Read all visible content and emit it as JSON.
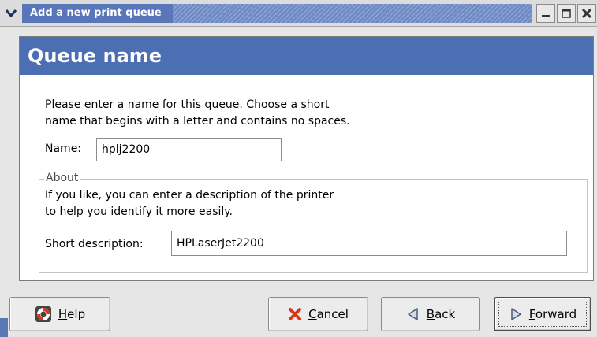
{
  "window": {
    "title": "Add a new print queue"
  },
  "header": {
    "title": "Queue name"
  },
  "instructions": {
    "line1": "Please enter a name for this queue.  Choose a short",
    "line2": "name that begins with a letter and contains no spaces."
  },
  "name_field": {
    "label": "Name:",
    "value": "hplj2200"
  },
  "about": {
    "legend": "About",
    "line1": "If you like, you can enter a description of the printer",
    "line2": "to help you identify it more easily.",
    "short_label": "Short description:",
    "short_value": "HPLaserJet2200"
  },
  "buttons": {
    "help": "Help",
    "cancel": "Cancel",
    "back": "Back",
    "forward": "Forward"
  },
  "colors": {
    "header_bg": "#4c6fb4",
    "titlebar_accent": "#5976b8",
    "cancel_icon": "#d9361a"
  },
  "icons": {
    "window_menu": "chevron-down-icon",
    "minimize": "minimize-icon",
    "maximize": "maximize-icon",
    "close": "close-icon",
    "help": "lifebuoy-icon",
    "cancel": "cancel-x-icon",
    "back": "back-arrow-icon",
    "forward": "forward-arrow-icon"
  }
}
